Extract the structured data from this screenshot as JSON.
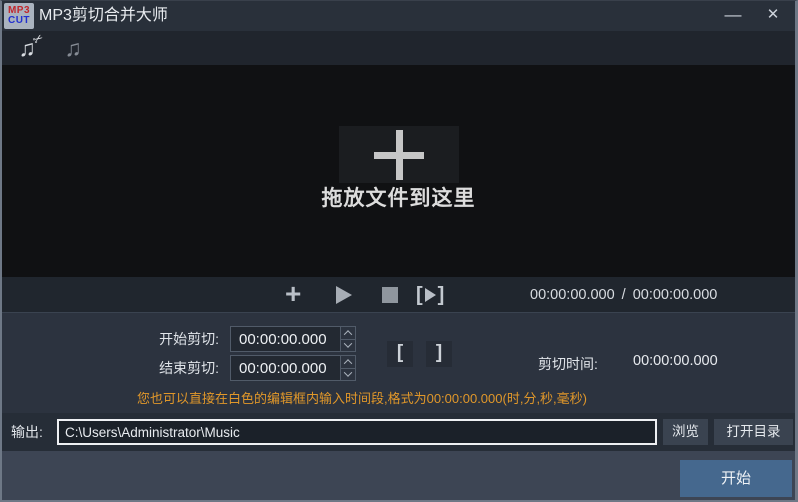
{
  "window": {
    "title": "MP3剪切合并大师",
    "logo_line1": "MP3",
    "logo_line2": "CUT",
    "minimize_glyph": "—",
    "close_glyph": "✕"
  },
  "toolbar": {
    "cut_note_glyph": "♫",
    "cut_scissors_glyph": "✂",
    "merge_note_glyph": "♫"
  },
  "dropzone": {
    "text": "拖放文件到这里"
  },
  "transport": {
    "add_glyph": "+",
    "elapsed": "00:00:00.000",
    "separator": "/",
    "total": "00:00:00.000"
  },
  "cut_panel": {
    "start_label": "开始剪切:",
    "start_value": "00:00:00.000",
    "end_label": "结束剪切:",
    "end_value": "00:00:00.000",
    "mark_in": "[",
    "mark_out": "]",
    "duration_label": "剪切时间:",
    "duration_value": "00:00:00.000",
    "hint": "您也可以直接在白色的编辑框内输入时间段,格式为00:00:00.000(时,分,秒,毫秒)"
  },
  "output": {
    "label": "输出:",
    "path": "C:\\Users\\Administrator\\Music",
    "browse_label": "浏览",
    "open_dir_label": "打开目录"
  },
  "footer": {
    "start_label": "开始"
  },
  "colors": {
    "accent_button": "#45688e",
    "hint_text": "#e0972a",
    "logo_red": "#c1272d",
    "logo_blue": "#2230cf",
    "dropzone_bg": "#101113",
    "panel_bg": "#2c333f"
  }
}
